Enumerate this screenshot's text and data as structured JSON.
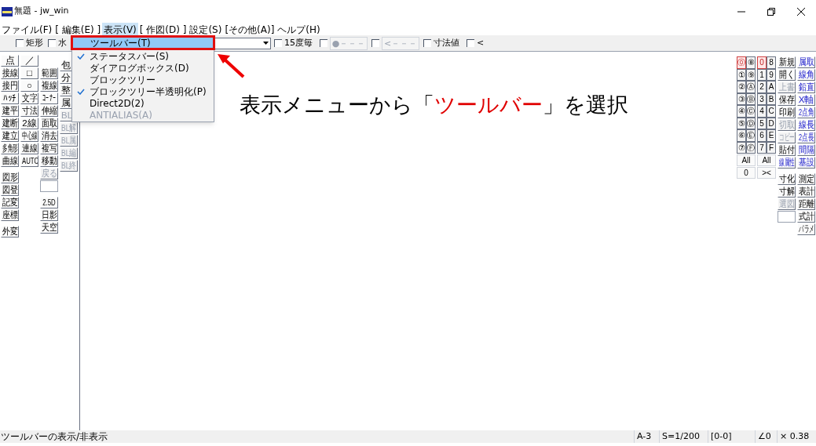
{
  "window": {
    "title": "無題 - jw_win"
  },
  "menu_bar": [
    {
      "label": "ファイル(F)",
      "selected": false
    },
    {
      "label": "[ 編集(E) ]",
      "selected": false
    },
    {
      "label": "表示(V)",
      "selected": true
    },
    {
      "label": "[ 作図(D) ]",
      "selected": false
    },
    {
      "label": "設定(S)",
      "selected": false
    },
    {
      "label": "[その他(A)]",
      "selected": false
    },
    {
      "label": "ヘルプ(H)",
      "selected": false
    }
  ],
  "toolbar": {
    "checks": [
      {
        "label": "矩形",
        "checked": false
      },
      {
        "label": "水",
        "checked": false
      }
    ],
    "options": [
      {
        "kind": "check",
        "label": "15度毎",
        "checked": false
      },
      {
        "kind": "check",
        "checked": false
      },
      {
        "kind": "button",
        "label": "●－－－",
        "disabled": true
      },
      {
        "kind": "check",
        "checked": false
      },
      {
        "kind": "button",
        "label": "<－－－",
        "disabled": true
      },
      {
        "kind": "check",
        "label": "寸法値",
        "checked": false
      },
      {
        "kind": "check",
        "label": "<",
        "checked": false
      }
    ]
  },
  "left_toolbar": [
    {
      "groups": [
        [
          {
            "kind": "button",
            "label": "点",
            "disabled": false
          },
          {
            "kind": "button",
            "label": "接線",
            "disabled": false
          },
          {
            "kind": "button",
            "label": "接円",
            "disabled": false
          },
          {
            "kind": "button",
            "label": "ﾊｯﾁ",
            "disabled": false
          },
          {
            "kind": "button",
            "label": "建平",
            "disabled": false
          },
          {
            "kind": "button",
            "label": "建断",
            "disabled": false
          },
          {
            "kind": "button",
            "label": "建立",
            "disabled": false
          },
          {
            "kind": "button",
            "label": "多角形",
            "disabled": false
          },
          {
            "kind": "button",
            "label": "曲線",
            "disabled": false
          }
        ],
        [
          {
            "kind": "button",
            "label": "図形",
            "disabled": false
          },
          {
            "kind": "button",
            "label": "図登",
            "disabled": false
          },
          {
            "kind": "button",
            "label": "記変",
            "disabled": false
          },
          {
            "kind": "button",
            "label": "座標",
            "disabled": false
          }
        ],
        [
          {
            "kind": "button",
            "label": "外変",
            "disabled": false
          }
        ]
      ]
    },
    {
      "groups": [
        [
          {
            "kind": "button",
            "label": "／",
            "disabled": false
          },
          {
            "kind": "button",
            "label": "□",
            "disabled": false
          },
          {
            "kind": "button",
            "label": "○",
            "disabled": false
          },
          {
            "kind": "button",
            "label": "文字",
            "disabled": false
          },
          {
            "kind": "button",
            "label": "寸法",
            "disabled": false
          },
          {
            "kind": "button",
            "label": "2線",
            "disabled": false
          },
          {
            "kind": "button",
            "label": "中心線",
            "disabled": false
          },
          {
            "kind": "button",
            "label": "連線",
            "disabled": false
          },
          {
            "kind": "button",
            "label": "AUTO",
            "disabled": false
          }
        ]
      ]
    },
    {
      "groups": [
        [
          {
            "kind": "button",
            "label": "範囲",
            "disabled": false
          },
          {
            "kind": "button",
            "label": "複線",
            "disabled": false
          },
          {
            "kind": "button",
            "label": "ｺｰﾅｰ",
            "disabled": false
          },
          {
            "kind": "button",
            "label": "伸縮",
            "disabled": false
          },
          {
            "kind": "button",
            "label": "面取",
            "disabled": false
          },
          {
            "kind": "button",
            "label": "消去",
            "disabled": false
          },
          {
            "kind": "button",
            "label": "複写",
            "disabled": false
          },
          {
            "kind": "button",
            "label": "移動",
            "disabled": false
          },
          {
            "kind": "button",
            "label": "戻る",
            "disabled": true
          },
          {
            "kind": "field"
          }
        ],
        [
          {
            "kind": "button",
            "label": "2.5D",
            "disabled": false
          },
          {
            "kind": "button",
            "label": "日影",
            "disabled": false
          },
          {
            "kind": "button",
            "label": "天空",
            "disabled": false
          }
        ]
      ]
    },
    {
      "groups": [
        [
          {
            "kind": "button",
            "label": "包",
            "disabled": false
          },
          {
            "kind": "button",
            "label": "分",
            "disabled": false
          },
          {
            "kind": "button",
            "label": "整",
            "disabled": false
          },
          {
            "kind": "button",
            "label": "属",
            "disabled": false
          },
          {
            "kind": "button",
            "label": "BL",
            "disabled": true
          },
          {
            "kind": "button",
            "label": "BL解",
            "disabled": true
          },
          {
            "kind": "button",
            "label": "BL属",
            "disabled": true
          },
          {
            "kind": "button",
            "label": "BL編",
            "disabled": true
          },
          {
            "kind": "button",
            "label": "BL終",
            "disabled": true
          }
        ]
      ]
    }
  ],
  "layer_groups": [
    {
      "layers": [
        {
          "label": "⓪",
          "selected": true
        },
        {
          "label": "⑧",
          "selected": false
        },
        {
          "label": "①",
          "selected": false
        },
        {
          "label": "⑨",
          "selected": false
        },
        {
          "label": "②",
          "selected": false
        },
        {
          "label": "Ⓐ",
          "selected": false
        },
        {
          "label": "③",
          "selected": false
        },
        {
          "label": "Ⓑ",
          "selected": false
        },
        {
          "label": "④",
          "selected": false
        },
        {
          "label": "Ⓒ",
          "selected": false
        },
        {
          "label": "⑤",
          "selected": false
        },
        {
          "label": "Ⓓ",
          "selected": false
        },
        {
          "label": "⑥",
          "selected": false
        },
        {
          "label": "Ⓔ",
          "selected": false
        },
        {
          "label": "⑦",
          "selected": false
        },
        {
          "label": "Ⓕ",
          "selected": false
        }
      ],
      "all_label": "All",
      "bottom_label": "0"
    },
    {
      "layers": [
        {
          "label": "0",
          "selected": true
        },
        {
          "label": "8",
          "selected": false
        },
        {
          "label": "1",
          "selected": false
        },
        {
          "label": "9",
          "selected": false
        },
        {
          "label": "2",
          "selected": false
        },
        {
          "label": "A",
          "selected": false
        },
        {
          "label": "3",
          "selected": false
        },
        {
          "label": "B",
          "selected": false
        },
        {
          "label": "4",
          "selected": false
        },
        {
          "label": "C",
          "selected": false
        },
        {
          "label": "5",
          "selected": false
        },
        {
          "label": "D",
          "selected": false
        },
        {
          "label": "6",
          "selected": false
        },
        {
          "label": "E",
          "selected": false
        },
        {
          "label": "7",
          "selected": false
        },
        {
          "label": "F",
          "selected": false
        }
      ],
      "all_label": "All",
      "bottom_label": "><"
    }
  ],
  "right_toolbar": [
    {
      "groups": [
        [
          {
            "kind": "button",
            "label": "新規",
            "disabled": false,
            "highlighted": false
          },
          {
            "kind": "button",
            "label": "開く",
            "disabled": false,
            "highlighted": false
          },
          {
            "kind": "button",
            "label": "上書",
            "disabled": true,
            "highlighted": false
          },
          {
            "kind": "button",
            "label": "保存",
            "disabled": false,
            "highlighted": false
          },
          {
            "kind": "button",
            "label": "印刷",
            "disabled": false,
            "highlighted": false
          },
          {
            "kind": "button",
            "label": "切取",
            "disabled": true,
            "highlighted": false
          },
          {
            "kind": "button",
            "label": "コピー",
            "disabled": true,
            "highlighted": false
          },
          {
            "kind": "button",
            "label": "貼付",
            "disabled": false,
            "highlighted": false
          },
          {
            "kind": "button",
            "label": "線属性",
            "disabled": false,
            "highlighted": true
          }
        ],
        [
          {
            "kind": "button",
            "label": "寸化",
            "disabled": false,
            "highlighted": false
          },
          {
            "kind": "button",
            "label": "寸解",
            "disabled": false,
            "highlighted": false
          },
          {
            "kind": "button",
            "label": "選図",
            "disabled": true,
            "highlighted": false
          },
          {
            "kind": "field"
          }
        ]
      ]
    },
    {
      "groups": [
        [
          {
            "kind": "button",
            "label": "属取",
            "disabled": false,
            "highlighted": true
          },
          {
            "kind": "button",
            "label": "線角",
            "disabled": false,
            "highlighted": true
          },
          {
            "kind": "button",
            "label": "鉛直",
            "disabled": false,
            "highlighted": true
          },
          {
            "kind": "button",
            "label": "X軸",
            "disabled": false,
            "highlighted": true
          },
          {
            "kind": "button",
            "label": "2点角",
            "disabled": false,
            "highlighted": true
          },
          {
            "kind": "button",
            "label": "線長",
            "disabled": false,
            "highlighted": true
          },
          {
            "kind": "button",
            "label": "2点長",
            "disabled": false,
            "highlighted": true
          },
          {
            "kind": "button",
            "label": "間隔",
            "disabled": false,
            "highlighted": true
          },
          {
            "kind": "button",
            "label": "基設",
            "disabled": false,
            "highlighted": true
          }
        ],
        [
          {
            "kind": "button",
            "label": "測定",
            "disabled": false,
            "highlighted": false
          },
          {
            "kind": "button",
            "label": "表計",
            "disabled": false,
            "highlighted": false
          },
          {
            "kind": "button",
            "label": "距離",
            "disabled": false,
            "highlighted": false
          },
          {
            "kind": "button",
            "label": "式計",
            "disabled": false,
            "highlighted": false
          },
          {
            "kind": "button",
            "label": "パラメ",
            "disabled": false,
            "highlighted": false
          }
        ]
      ]
    }
  ],
  "view_menu": [
    {
      "label": "ツールバー(T)",
      "checked": false,
      "selected": true,
      "disabled": false
    },
    {
      "label": "ステータスバー(S)",
      "checked": true,
      "selected": false,
      "disabled": false
    },
    {
      "label": "ダイアログボックス(D)",
      "checked": false,
      "selected": false,
      "disabled": false
    },
    {
      "label": "ブロックツリー",
      "checked": false,
      "selected": false,
      "disabled": false
    },
    {
      "label": "ブロックツリー半透明化(P)",
      "checked": true,
      "selected": false,
      "disabled": false
    },
    {
      "label": "Direct2D(2)",
      "checked": false,
      "selected": false,
      "disabled": false
    },
    {
      "label": "ANTIALIAS(A)",
      "checked": false,
      "selected": false,
      "disabled": true
    }
  ],
  "annotation": {
    "parts": [
      {
        "kind": "plain",
        "text": "表示メニューから「"
      },
      {
        "kind": "emphasis",
        "text": "ツールバー"
      },
      {
        "kind": "plain",
        "text": "」を選択"
      }
    ]
  },
  "status_bar": {
    "message": "ツールバーの表示/非表示",
    "fields": [
      "A-3",
      "S=1/200",
      "[0-0]",
      "∠0",
      "× 0.38"
    ]
  }
}
